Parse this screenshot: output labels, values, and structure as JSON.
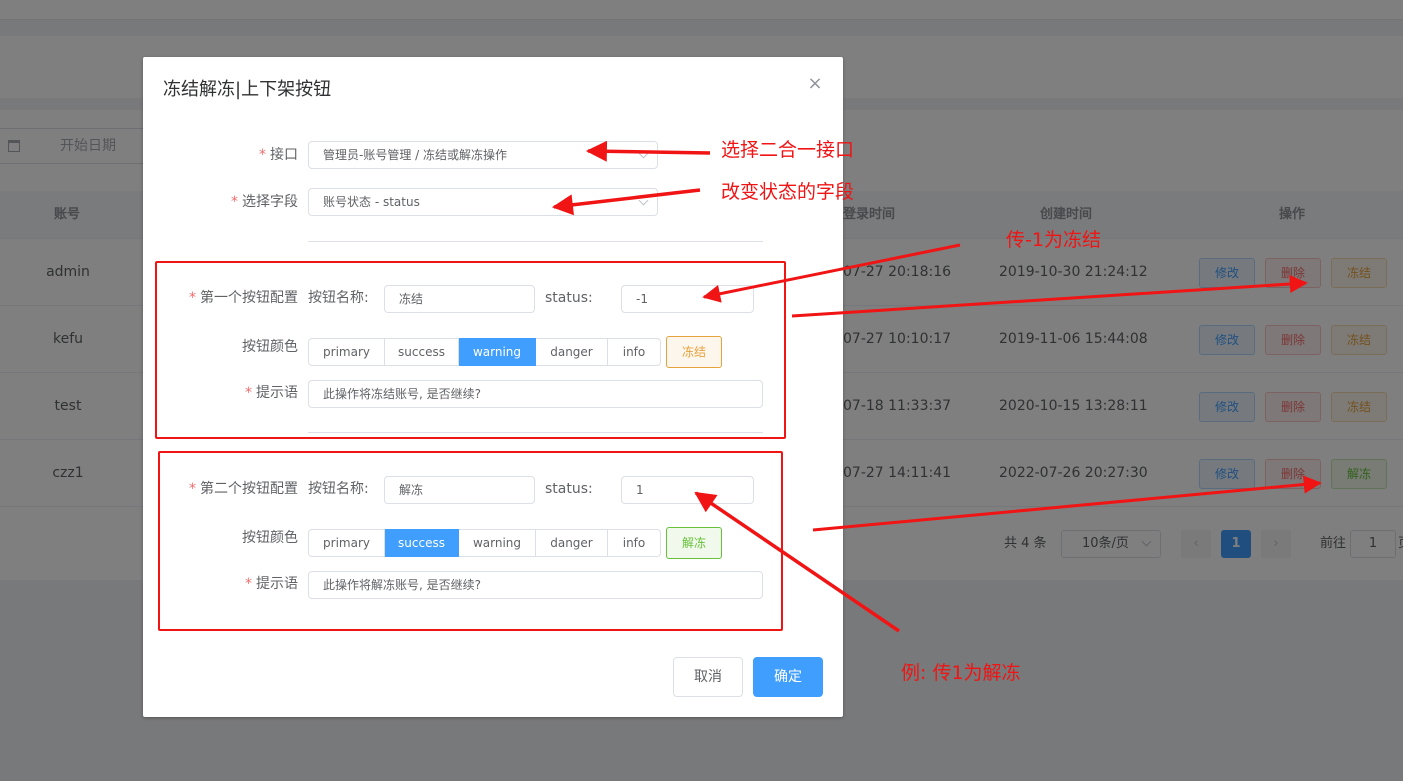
{
  "background": {
    "date_placeholder": "开始日期",
    "columns": {
      "account": "账号",
      "last_login": "登录时间",
      "created": "创建时间",
      "actions": "操作"
    },
    "rows": [
      {
        "account": "admin",
        "last_login": "07-27 20:18:16",
        "created": "2019-10-30 21:24:12",
        "toggle": "冻结",
        "toggle_type": "warning"
      },
      {
        "account": "kefu",
        "last_login": "07-27 10:10:17",
        "created": "2019-11-06 15:44:08",
        "toggle": "冻结",
        "toggle_type": "warning"
      },
      {
        "account": "test",
        "last_login": "07-18 11:33:37",
        "created": "2020-10-15 13:28:11",
        "toggle": "冻结",
        "toggle_type": "warning"
      },
      {
        "account": "czz1",
        "last_login": "07-27 14:11:41",
        "created": "2022-07-26 20:27:30",
        "toggle": "解冻",
        "toggle_type": "success"
      }
    ],
    "edit_label": "修改",
    "delete_label": "删除",
    "pagination": {
      "total": "共 4 条",
      "page_size": "10条/页",
      "current_page": "1",
      "goto_label": "前往",
      "goto_value": "1",
      "goto_suffix": "页"
    }
  },
  "dialog": {
    "title": "冻结解冻|上下架按钮",
    "close_glyph": "×",
    "interface_label": "接口",
    "interface_value": "管理员-账号管理 / 冻结或解冻操作",
    "field_label": "选择字段",
    "field_value": "账号状态 - status",
    "first": {
      "label": "第一个按钮配置",
      "name_label": "按钮名称:",
      "name_value": "冻结",
      "status_label": "status:",
      "status_value": "-1",
      "color_label": "按钮颜色",
      "color_options": [
        "primary",
        "success",
        "warning",
        "danger",
        "info"
      ],
      "selected_color": "warning",
      "preview": "冻结",
      "tip_label": "提示语",
      "tip_value": "此操作将冻结账号, 是否继续?"
    },
    "second": {
      "label": "第二个按钮配置",
      "name_label": "按钮名称:",
      "name_value": "解冻",
      "status_label": "status:",
      "status_value": "1",
      "color_label": "按钮颜色",
      "color_options": [
        "primary",
        "success",
        "warning",
        "danger",
        "info"
      ],
      "selected_color": "success",
      "preview": "解冻",
      "tip_label": "提示语",
      "tip_value": "此操作将解冻账号, 是否继续?"
    },
    "cancel_label": "取消",
    "ok_label": "确定"
  },
  "annotations": {
    "note_interface": "选择二合一接口",
    "note_field": "改变状态的字段",
    "note_freeze": "传-1为冻结",
    "note_unfreeze": "例: 传1为解冻",
    "color": "#f01414"
  }
}
